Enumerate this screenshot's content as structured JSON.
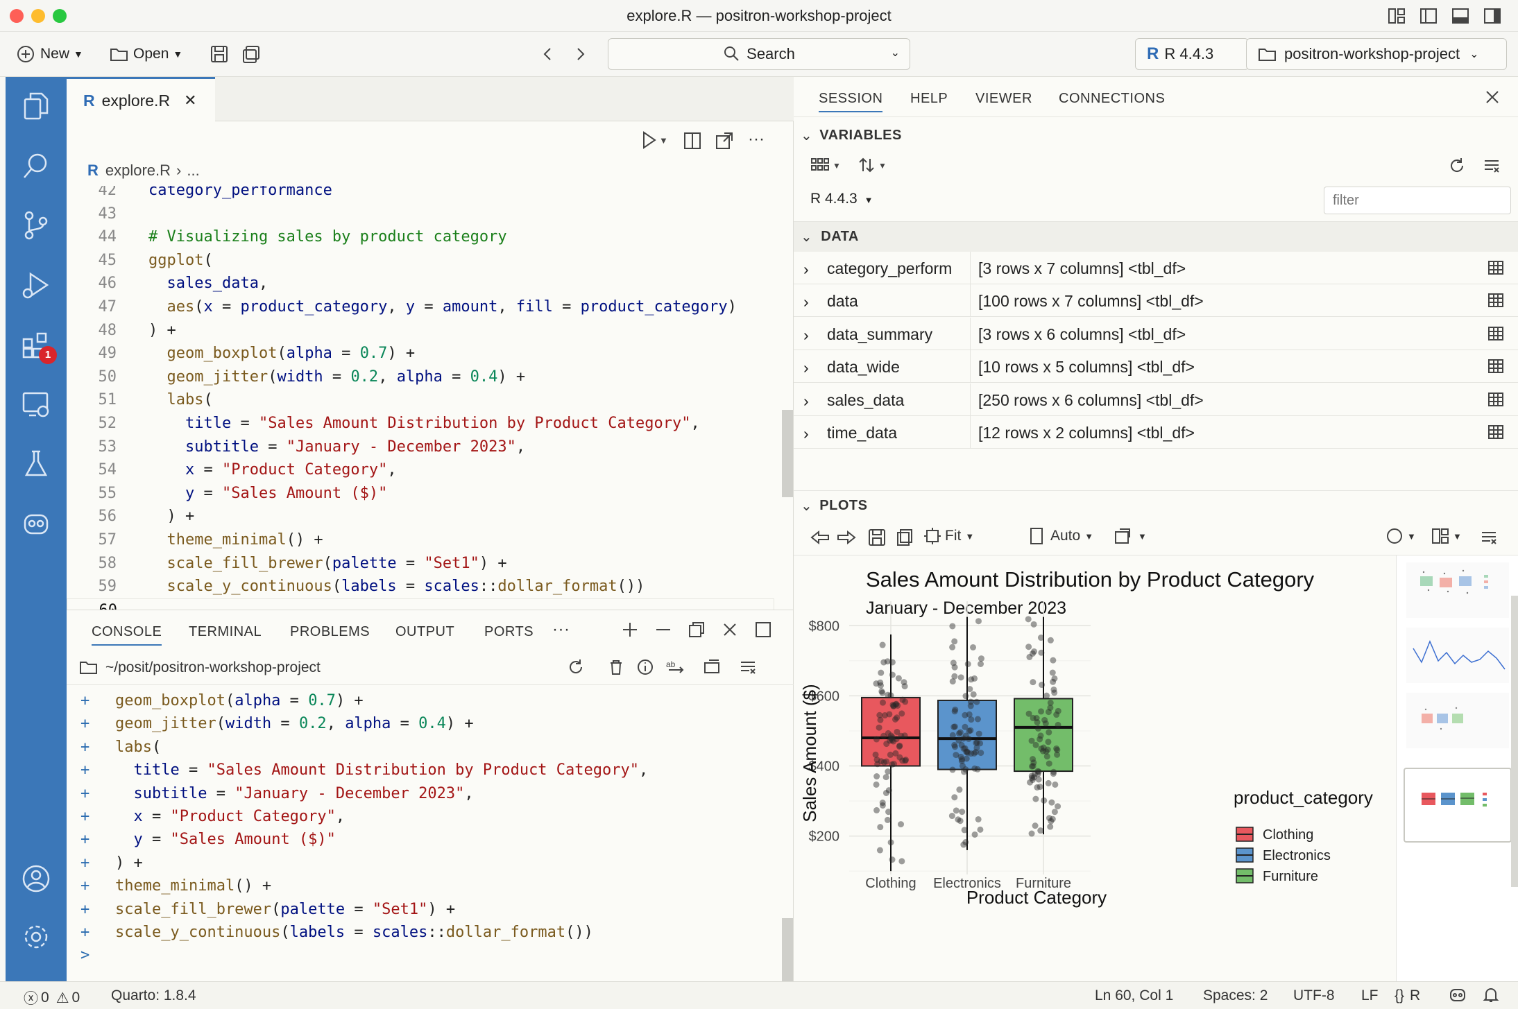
{
  "window": {
    "title": "explore.R — positron-workshop-project"
  },
  "toolbar": {
    "new_label": "New",
    "open_label": "Open",
    "search_label": "Search",
    "r_version": "R 4.4.3",
    "project_label": "positron-workshop-project"
  },
  "activity": {
    "extensions_badge": "1"
  },
  "editor": {
    "tab_label": "explore.R",
    "breadcrumb_file": "explore.R",
    "breadcrumb_rest": "...",
    "lines": [
      {
        "n": "42",
        "t": "  category_performance"
      },
      {
        "n": "43",
        "t": ""
      },
      {
        "n": "44",
        "t": "  # Visualizing sales by product category"
      },
      {
        "n": "45",
        "t": "  ggplot("
      },
      {
        "n": "46",
        "t": "    sales_data,"
      },
      {
        "n": "47",
        "t": "    aes(x = product_category, y = amount, fill = product_category)"
      },
      {
        "n": "48",
        "t": "  ) +"
      },
      {
        "n": "49",
        "t": "    geom_boxplot(alpha = 0.7) +"
      },
      {
        "n": "50",
        "t": "    geom_jitter(width = 0.2, alpha = 0.4) +"
      },
      {
        "n": "51",
        "t": "    labs("
      },
      {
        "n": "52",
        "t": "      title = \"Sales Amount Distribution by Product Category\","
      },
      {
        "n": "53",
        "t": "      subtitle = \"January - December 2023\","
      },
      {
        "n": "54",
        "t": "      x = \"Product Category\","
      },
      {
        "n": "55",
        "t": "      y = \"Sales Amount ($)\""
      },
      {
        "n": "56",
        "t": "    ) +"
      },
      {
        "n": "57",
        "t": "    theme_minimal() +"
      },
      {
        "n": "58",
        "t": "    scale_fill_brewer(palette = \"Set1\") +"
      },
      {
        "n": "59",
        "t": "    scale_y_continuous(labels = scales::dollar_format())"
      },
      {
        "n": "60",
        "t": ""
      }
    ]
  },
  "panel": {
    "tabs": [
      "CONSOLE",
      "TERMINAL",
      "PROBLEMS",
      "OUTPUT",
      "PORTS"
    ],
    "path": "~/posit/positron-workshop-project",
    "lines": [
      {
        "p": "+",
        "t": "geom_boxplot(alpha = 0.7) +"
      },
      {
        "p": "+",
        "t": "geom_jitter(width = 0.2, alpha = 0.4) +"
      },
      {
        "p": "+",
        "t": "labs("
      },
      {
        "p": "+",
        "t": "  title = \"Sales Amount Distribution by Product Category\","
      },
      {
        "p": "+",
        "t": "  subtitle = \"January - December 2023\","
      },
      {
        "p": "+",
        "t": "  x = \"Product Category\","
      },
      {
        "p": "+",
        "t": "  y = \"Sales Amount ($)\""
      },
      {
        "p": "+",
        "t": ") +"
      },
      {
        "p": "+",
        "t": "theme_minimal() +"
      },
      {
        "p": "+",
        "t": "scale_fill_brewer(palette = \"Set1\") +"
      },
      {
        "p": "+",
        "t": "scale_y_continuous(labels = scales::dollar_format())"
      },
      {
        "p": ">",
        "t": ""
      }
    ]
  },
  "session": {
    "tabs": [
      "SESSION",
      "HELP",
      "VIEWER",
      "CONNECTIONS"
    ],
    "variables_label": "VARIABLES",
    "r_version": "R 4.4.3",
    "filter_placeholder": "filter",
    "data_label": "DATA",
    "rows": [
      {
        "name": "category_perform",
        "value": "[3 rows x 7 columns] <tbl_df>"
      },
      {
        "name": "data",
        "value": "[100 rows x 7 columns] <tbl_df>"
      },
      {
        "name": "data_summary",
        "value": "[3 rows x 6 columns] <tbl_df>"
      },
      {
        "name": "data_wide",
        "value": "[10 rows x 5 columns] <tbl_df>"
      },
      {
        "name": "sales_data",
        "value": "[250 rows x 6 columns] <tbl_df>"
      },
      {
        "name": "time_data",
        "value": "[12 rows x 2 columns] <tbl_df>"
      }
    ],
    "plots_label": "PLOTS",
    "fit_label": "Fit",
    "auto_label": "Auto"
  },
  "plot": {
    "title": "Sales Amount Distribution by Product Category",
    "subtitle": "January - December 2023",
    "xlabel": "Product Category",
    "ylabel": "Sales Amount ($)",
    "legend_title": "product_category",
    "yticks": [
      "$200",
      "$400",
      "$600",
      "$800"
    ],
    "categories": [
      "Clothing",
      "Electronics",
      "Furniture"
    ]
  },
  "chart_data": {
    "type": "box",
    "title": "Sales Amount Distribution by Product Category",
    "subtitle": "January - December 2023",
    "xlabel": "Product Category",
    "ylabel": "Sales Amount ($)",
    "ylim": [
      130,
      850
    ],
    "yticks": [
      200,
      400,
      600,
      800
    ],
    "grid": true,
    "legend": "right",
    "colors": [
      "#e8585e",
      "#5b94cc",
      "#73bd6a"
    ],
    "series": [
      {
        "name": "Clothing",
        "min": 100,
        "q1": 400,
        "median": 480,
        "q3": 595,
        "max": 775
      },
      {
        "name": "Electronics",
        "min": 160,
        "q1": 390,
        "median": 478,
        "q3": 587,
        "max": 825
      },
      {
        "name": "Furniture",
        "min": 205,
        "q1": 385,
        "median": 510,
        "q3": 592,
        "max": 825
      }
    ]
  },
  "status": {
    "errors": "0",
    "warnings": "0",
    "quarto": "Quarto: 1.8.4",
    "position": "Ln 60, Col 1",
    "spaces": "Spaces: 2",
    "encoding": "UTF-8",
    "eol": "LF",
    "language": "R",
    "braces": "{}"
  }
}
